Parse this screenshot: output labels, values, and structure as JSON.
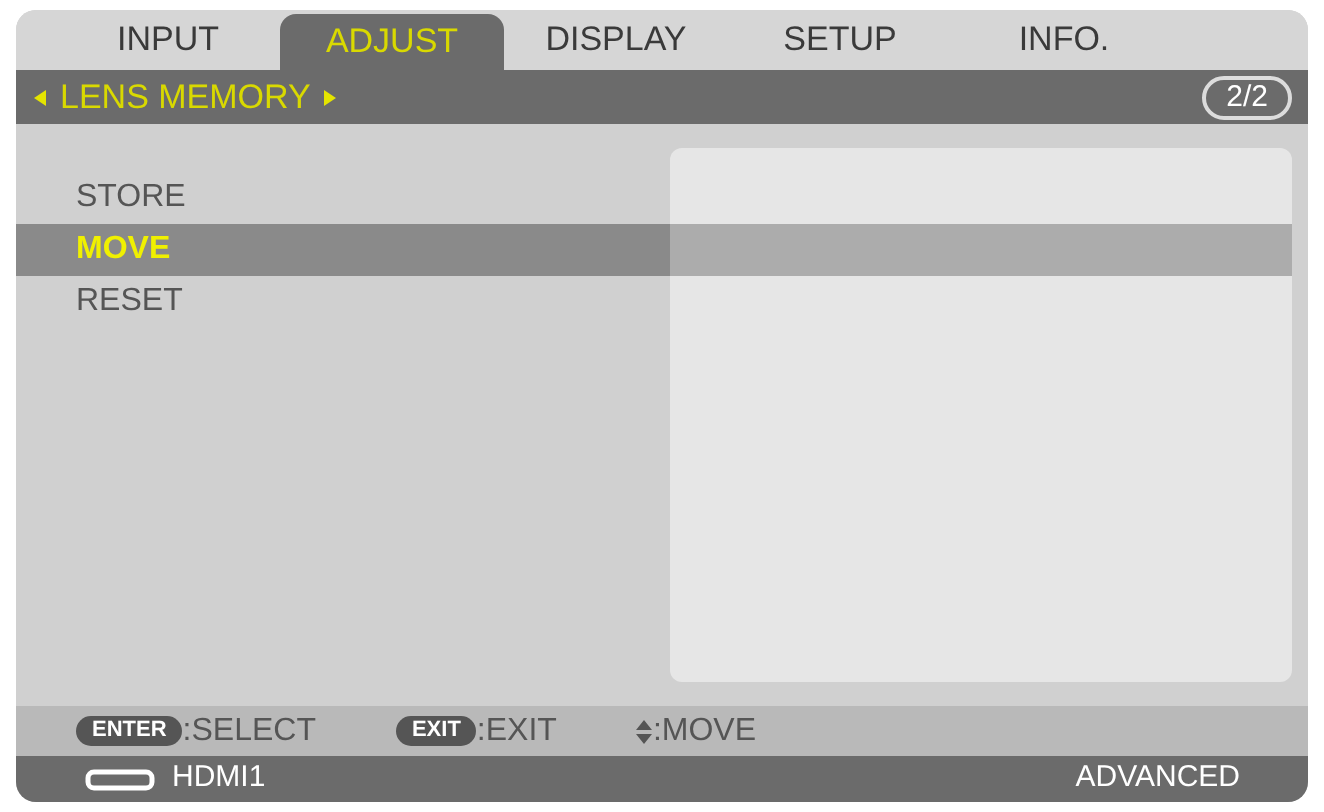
{
  "tabs": [
    {
      "label": "INPUT",
      "selected": false
    },
    {
      "label": "ADJUST",
      "selected": true
    },
    {
      "label": "DISPLAY",
      "selected": false
    },
    {
      "label": "SETUP",
      "selected": false
    },
    {
      "label": "INFO.",
      "selected": false
    }
  ],
  "header": {
    "title": "LENS MEMORY",
    "page": "2/2"
  },
  "menu": [
    {
      "label": "STORE",
      "selected": false
    },
    {
      "label": "MOVE",
      "selected": true
    },
    {
      "label": "RESET",
      "selected": false
    }
  ],
  "hints": [
    {
      "kind": "key",
      "key": "ENTER",
      "text": ":SELECT"
    },
    {
      "kind": "key",
      "key": "EXIT",
      "text": ":EXIT"
    },
    {
      "kind": "arrows",
      "text": ":MOVE"
    }
  ],
  "status_bar": {
    "source": "HDMI1",
    "mode": "ADVANCED"
  }
}
